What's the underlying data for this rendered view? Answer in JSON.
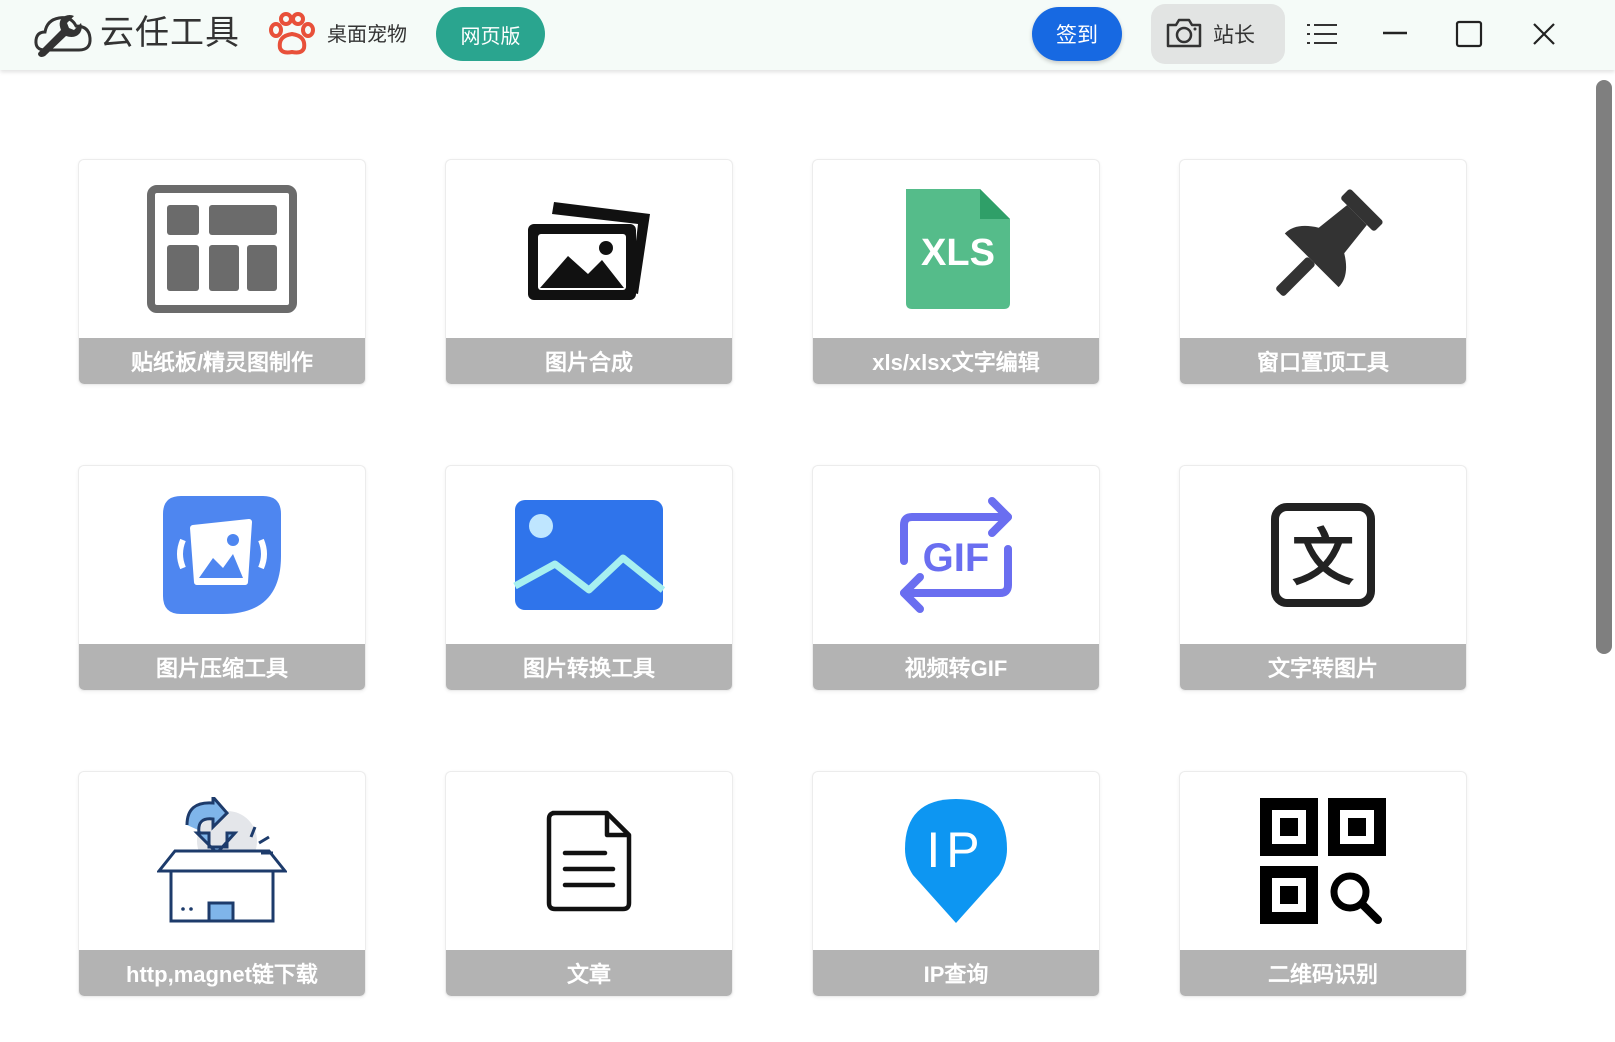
{
  "header": {
    "app_title": "云任工具",
    "pet_label": "桌面宠物",
    "web_version_label": "网页版",
    "sign_in_label": "签到",
    "screenshot_label": "站长",
    "colors": {
      "accent_green": "#2aa58f",
      "accent_blue": "#1769e2",
      "bar_bg": "#f5fbf8"
    }
  },
  "tools": [
    {
      "label": "贴纸板/精灵图制作",
      "icon": "layout-grid-icon"
    },
    {
      "label": "图片合成",
      "icon": "photos-stack-icon"
    },
    {
      "label": "xls/xlsx文字编辑",
      "icon": "xls-file-icon",
      "icon_text": "XLS"
    },
    {
      "label": "窗口置顶工具",
      "icon": "pin-icon"
    },
    {
      "label": "图片压缩工具",
      "icon": "image-compress-icon"
    },
    {
      "label": "图片转换工具",
      "icon": "image-icon"
    },
    {
      "label": "视频转GIF",
      "icon": "gif-convert-icon",
      "icon_text": "GIF"
    },
    {
      "label": "文字转图片",
      "icon": "text-char-icon",
      "icon_text": "文"
    },
    {
      "label": "http,magnet链下载",
      "icon": "download-box-icon"
    },
    {
      "label": "文章",
      "icon": "document-icon"
    },
    {
      "label": "IP查询",
      "icon": "ip-location-icon",
      "icon_text": "IP"
    },
    {
      "label": "二维码识别",
      "icon": "qr-scan-icon"
    }
  ]
}
